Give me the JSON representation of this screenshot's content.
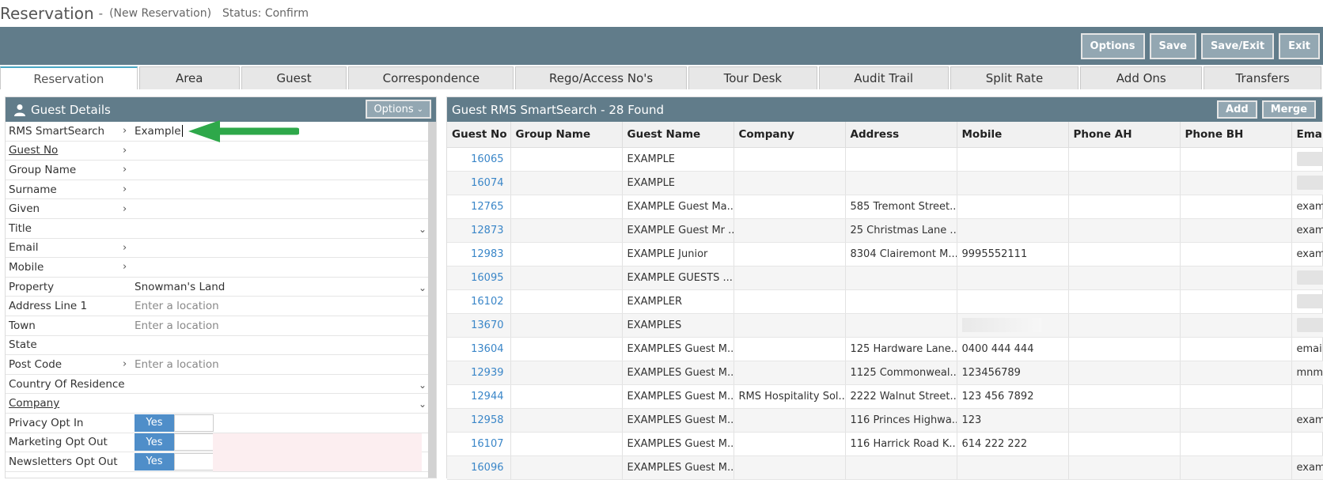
{
  "header": {
    "title": "Reservation",
    "separator": "-",
    "subtitle": "(New Reservation)",
    "status": "Status: Confirm"
  },
  "toolbar": {
    "buttons": [
      "Options",
      "Save",
      "Save/Exit",
      "Exit"
    ]
  },
  "tabs": [
    {
      "label": "Reservation",
      "active": true
    },
    {
      "label": "Area"
    },
    {
      "label": "Guest"
    },
    {
      "label": "Correspondence"
    },
    {
      "label": "Rego/Access No's"
    },
    {
      "label": "Tour Desk"
    },
    {
      "label": "Audit Trail"
    },
    {
      "label": "Split Rate"
    },
    {
      "label": "Add Ons"
    },
    {
      "label": "Transfers"
    }
  ],
  "guest_details": {
    "title": "Guest Details",
    "options_label": "Options",
    "fields": [
      {
        "label": "RMS SmartSearch",
        "chevron": true,
        "value": "Example"
      },
      {
        "label": "Guest No",
        "chevron": true,
        "value": ""
      },
      {
        "label": "Group Name",
        "chevron": true,
        "value": ""
      },
      {
        "label": "Surname",
        "chevron": true,
        "value": ""
      },
      {
        "label": "Given",
        "chevron": true,
        "value": ""
      },
      {
        "label": "Title",
        "chevron": false,
        "value": ""
      },
      {
        "label": "Email",
        "chevron": true,
        "value": ""
      },
      {
        "label": "Mobile",
        "chevron": true,
        "value": ""
      },
      {
        "label": "Property",
        "chevron": false,
        "value": "Snowman's Land"
      },
      {
        "label": "Address Line 1",
        "chevron": false,
        "placeholder": "Enter a location"
      },
      {
        "label": "Town",
        "chevron": false,
        "placeholder": "Enter a location"
      },
      {
        "label": "State",
        "chevron": false,
        "value": ""
      },
      {
        "label": "Post Code",
        "chevron": true,
        "placeholder": "Enter a location"
      },
      {
        "label": "Country Of Residence",
        "chevron": false,
        "value": ""
      },
      {
        "label": "Company",
        "chevron": false,
        "value": ""
      },
      {
        "label": "Privacy Opt In",
        "toggle": "Yes"
      },
      {
        "label": "Marketing Opt Out",
        "toggle": "Yes"
      },
      {
        "label": "Newsletters Opt Out",
        "toggle": "Yes"
      }
    ]
  },
  "smartsearch": {
    "title": "Guest RMS SmartSearch - 28 Found",
    "buttons": [
      "Add",
      "Merge"
    ],
    "columns": [
      "Guest No",
      "Group Name",
      "Guest Name",
      "Company",
      "Address",
      "Mobile",
      "Phone AH",
      "Phone BH",
      "Emai"
    ],
    "rows": [
      [
        "16065",
        "",
        "EXAMPLE",
        "",
        "",
        "",
        "",
        "",
        ""
      ],
      [
        "16074",
        "",
        "EXAMPLE",
        "",
        "",
        "",
        "",
        "",
        ""
      ],
      [
        "12765",
        "",
        "EXAMPLE Guest Ma...",
        "",
        "585 Tremont Street...",
        "",
        "",
        "",
        "exam"
      ],
      [
        "12873",
        "",
        "EXAMPLE Guest Mr ...",
        "",
        "25 Christmas Lane ...",
        "",
        "",
        "",
        "exam"
      ],
      [
        "12983",
        "",
        "EXAMPLE Junior",
        "",
        "8304 Clairemont M...",
        "9995552111",
        "",
        "",
        "exam"
      ],
      [
        "16095",
        "",
        "EXAMPLE GUESTS ...",
        "",
        "",
        "",
        "",
        "",
        ""
      ],
      [
        "16102",
        "",
        "EXAMPLER",
        "",
        "",
        "",
        "",
        "",
        ""
      ],
      [
        "13670",
        "",
        "EXAMPLES",
        "",
        "",
        "",
        "",
        "",
        ""
      ],
      [
        "13604",
        "",
        "EXAMPLES Guest M...",
        "",
        "125 Hardware Lane...",
        "0400 444 444",
        "",
        "",
        "email"
      ],
      [
        "12939",
        "",
        "EXAMPLES Guest M...",
        "",
        "1125 Commonweal...",
        "123456789",
        "",
        "",
        "mnm"
      ],
      [
        "12944",
        "",
        "EXAMPLES Guest M...",
        "RMS Hospitality Sol...",
        "2222 Walnut Street...",
        "123 456 7892",
        "",
        "",
        ""
      ],
      [
        "12958",
        "",
        "EXAMPLES Guest M...",
        "",
        "116 Princes Highwa...",
        "123",
        "",
        "",
        "exam"
      ],
      [
        "16107",
        "",
        "EXAMPLES Guest M...",
        "",
        "116 Harrick Road K...",
        "614 222 222",
        "",
        "",
        ""
      ],
      [
        "16096",
        "",
        "EXAMPLES Guest M...",
        "",
        "",
        "",
        "",
        "",
        "exam"
      ]
    ]
  },
  "colors": {
    "toolbar_bg": "#617c8a",
    "link_blue": "#3a86c8",
    "toggle_blue": "#4f8ec9",
    "arrow_green": "#2ea84a"
  }
}
